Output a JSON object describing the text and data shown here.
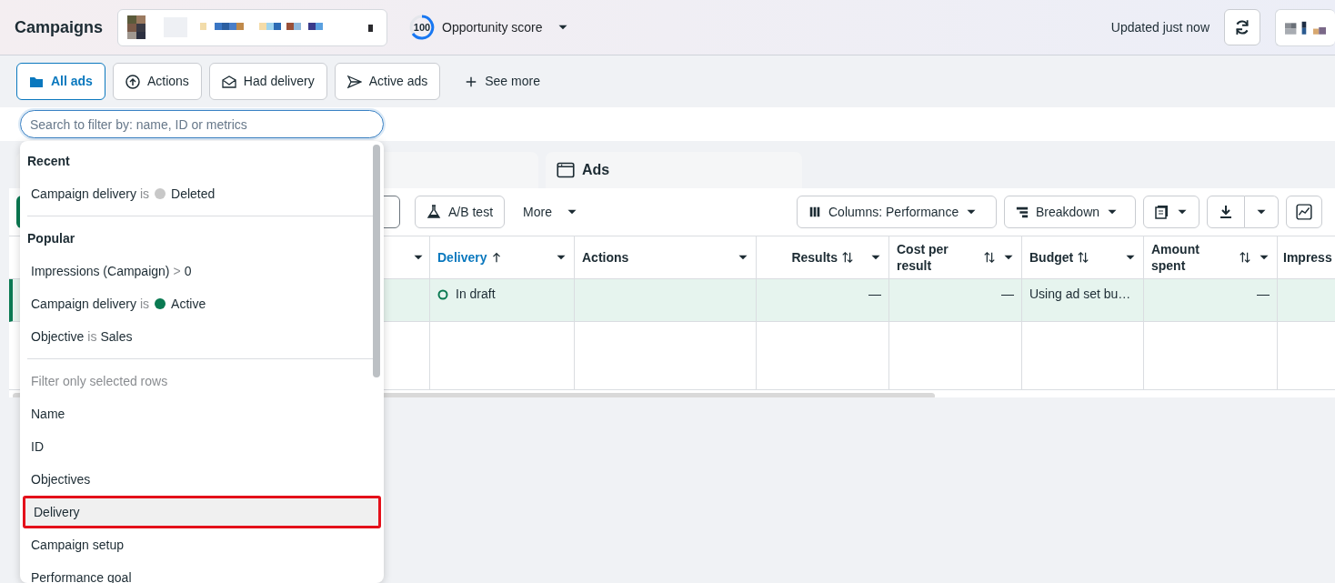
{
  "header": {
    "title": "Campaigns",
    "score": "100",
    "score_label": "Opportunity score",
    "updated": "Updated just now"
  },
  "filter_tabs": [
    {
      "label": "All ads",
      "selected": true
    },
    {
      "label": "Actions",
      "selected": false
    },
    {
      "label": "Had delivery",
      "selected": false
    },
    {
      "label": "Active ads",
      "selected": false
    }
  ],
  "see_more": "See more",
  "search": {
    "placeholder": "Search to filter by: name, ID or metrics"
  },
  "level_tabs": [
    {
      "label": "Ads",
      "selected": false
    }
  ],
  "toolbar": {
    "ab_test": "A/B test",
    "more": "More",
    "columns": "Columns: Performance",
    "breakdown": "Breakdown"
  },
  "table": {
    "columns": [
      {
        "label": "Delivery",
        "kind": "sorted"
      },
      {
        "label": "Actions",
        "kind": "plain"
      },
      {
        "label": "Results",
        "kind": "sortable"
      },
      {
        "label": "Cost per result",
        "kind": "sortable"
      },
      {
        "label": "Budget",
        "kind": "sortable"
      },
      {
        "label": "Amount spent",
        "kind": "sortable"
      },
      {
        "label": "Impress",
        "kind": "cut"
      }
    ],
    "rows": [
      {
        "selected": true,
        "cells": [
          "In draft",
          null,
          "—",
          "—",
          "Using ad set bu…",
          "—",
          null
        ]
      }
    ]
  },
  "dropdown": {
    "sections": [
      {
        "title": "Recent",
        "items": [
          {
            "field": "Campaign delivery",
            "op": "is",
            "value": "Deleted",
            "color": "#c8c8c8"
          }
        ]
      },
      {
        "title": "Popular",
        "items": [
          {
            "field": "Impressions (Campaign)",
            "op": ">",
            "value": "0"
          },
          {
            "field": "Campaign delivery",
            "op": "is",
            "value": "Active",
            "color": "#0a7a52"
          },
          {
            "field": "Objective",
            "op": "is",
            "value": "Sales"
          }
        ]
      }
    ],
    "hint": "Filter only selected rows",
    "fields": [
      {
        "label": "Name",
        "selected": false
      },
      {
        "label": "ID",
        "selected": false
      },
      {
        "label": "Objectives",
        "selected": false
      },
      {
        "label": "Delivery",
        "selected": true
      },
      {
        "label": "Campaign setup",
        "selected": false
      },
      {
        "label": "Performance goal",
        "selected": false
      }
    ]
  }
}
